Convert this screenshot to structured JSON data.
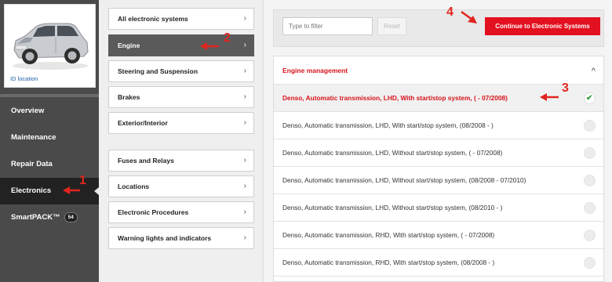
{
  "vehicle": {
    "id_location_label": "ID location"
  },
  "sidebar": {
    "items": [
      {
        "label": "Overview"
      },
      {
        "label": "Maintenance"
      },
      {
        "label": "Repair Data"
      },
      {
        "label": "Electronics"
      },
      {
        "label": "SmartPACK™",
        "badge": "54"
      }
    ]
  },
  "categories": {
    "group1": [
      {
        "label": "All electronic systems"
      },
      {
        "label": "Engine"
      },
      {
        "label": "Steering and Suspension"
      },
      {
        "label": "Brakes"
      },
      {
        "label": "Exterior/Interior"
      }
    ],
    "group2": [
      {
        "label": "Fuses and Relays"
      },
      {
        "label": "Locations"
      },
      {
        "label": "Electronic Procedures"
      },
      {
        "label": "Warning lights and indicators"
      }
    ],
    "chevron": "›"
  },
  "toolbar": {
    "filter_placeholder": "Type to filter",
    "reset_label": "Reset",
    "continue_label": "Continue to Electronic Systems"
  },
  "list": {
    "header": "Engine management",
    "collapse_glyph": "^",
    "rows": [
      {
        "label": "Denso, Automatic transmission, LHD, With start/stop system, ( - 07/2008)",
        "selected": true
      },
      {
        "label": "Denso, Automatic transmission, LHD, With start/stop system, (08/2008 - )",
        "selected": false
      },
      {
        "label": "Denso, Automatic transmission, LHD, Without start/stop system, ( - 07/2008)",
        "selected": false
      },
      {
        "label": "Denso, Automatic transmission, LHD, Without start/stop system, (08/2008 - 07/2010)",
        "selected": false
      },
      {
        "label": "Denso, Automatic transmission, LHD, Without start/stop system, (08/2010 - )",
        "selected": false
      },
      {
        "label": "Denso, Automatic transmission, RHD, With start/stop system, ( - 07/2008)",
        "selected": false
      },
      {
        "label": "Denso, Automatic transmission, RHD, With start/stop system, (08/2008 - )",
        "selected": false
      }
    ]
  },
  "callouts": [
    "1",
    "2",
    "3",
    "4"
  ],
  "colors": {
    "accent": "#e3101f",
    "sidebar_bg": "#4a4a4a",
    "active_nav": "#222222",
    "check": "#3a9d3a"
  }
}
